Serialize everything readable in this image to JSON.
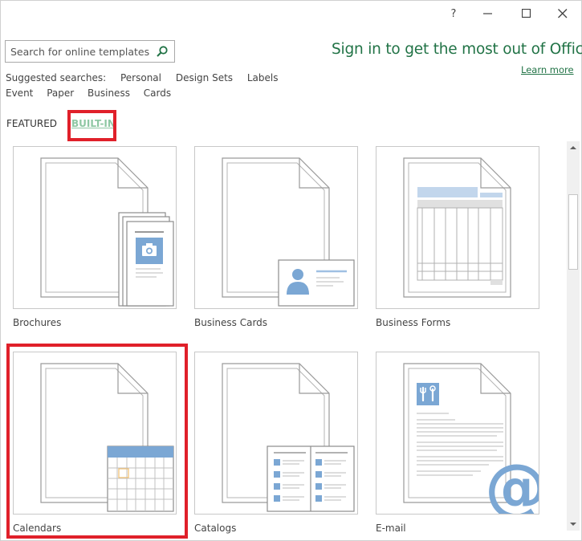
{
  "window": {
    "help_label": "?",
    "minimize_label": "—",
    "maximize_label": "□",
    "close_label": "✕"
  },
  "search": {
    "placeholder": "Search for online templates",
    "icon": "search-icon"
  },
  "signin": {
    "text": "Sign in to get the most out of Office",
    "learn_more": "Learn more"
  },
  "suggested": {
    "label": "Suggested searches:",
    "items": [
      "Personal",
      "Design Sets",
      "Labels",
      "Event",
      "Paper",
      "Business",
      "Cards"
    ]
  },
  "tabs": {
    "featured": "FEATURED",
    "built_in": "BUILT-IN"
  },
  "templates": [
    {
      "label": "Brochures",
      "icon": "brochure-icon"
    },
    {
      "label": "Business Cards",
      "icon": "business-card-icon"
    },
    {
      "label": "Business Forms",
      "icon": "business-form-icon"
    },
    {
      "label": "Calendars",
      "icon": "calendar-icon"
    },
    {
      "label": "Catalogs",
      "icon": "catalog-icon"
    },
    {
      "label": "E-mail",
      "icon": "email-icon"
    }
  ],
  "colors": {
    "accent_green": "#217346",
    "builtin_tab": "#8ec7a3",
    "highlight_red": "#e0202a",
    "icon_blue": "#7ba7d4"
  }
}
